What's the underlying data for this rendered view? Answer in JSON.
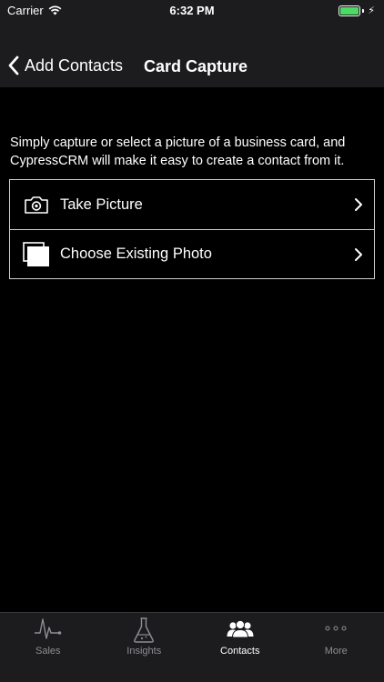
{
  "status_bar": {
    "carrier": "Carrier",
    "time": "6:32 PM",
    "battery_color": "#4cd964"
  },
  "nav": {
    "back_label": "Add Contacts",
    "title": "Card Capture"
  },
  "description": "Simply capture or select a picture of a business card, and CypressCRM will make it easy to create a contact from it.",
  "options": [
    {
      "label": "Take Picture",
      "icon": "camera-icon"
    },
    {
      "label": "Choose Existing Photo",
      "icon": "photos-icon"
    }
  ],
  "tabbar": {
    "items": [
      {
        "label": "Sales",
        "icon": "pulse-icon",
        "active": false
      },
      {
        "label": "Insights",
        "icon": "flask-icon",
        "active": false
      },
      {
        "label": "Contacts",
        "icon": "people-icon",
        "active": true
      },
      {
        "label": "More",
        "icon": "ellipsis-icon",
        "active": false
      }
    ]
  }
}
